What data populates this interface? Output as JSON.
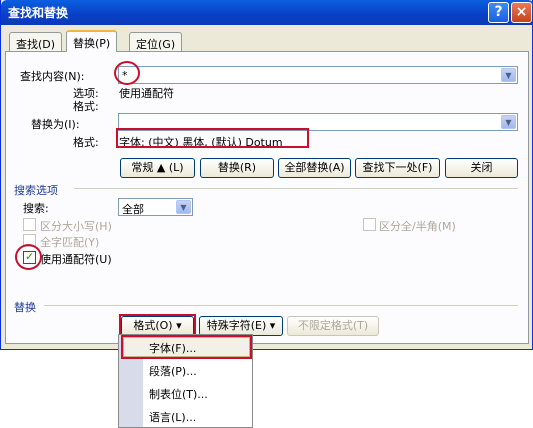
{
  "window": {
    "title": "查找和替换",
    "help": "?",
    "close": "×"
  },
  "tabs": [
    "查找(D)",
    "替换(P)",
    "定位(G)"
  ],
  "find": {
    "label": "查找内容(N):",
    "value": "*",
    "options_label": "选项:",
    "options_value": "使用通配符",
    "format_label": "格式:"
  },
  "replace": {
    "label": "替换为(I):",
    "value": "",
    "format_label": "格式:",
    "format_value": "字体: (中文) 黑体, (默认) Dotum"
  },
  "buttons": {
    "less": "常规 ▲ (L)",
    "replace": "替换(R)",
    "replace_all": "全部替换(A)",
    "find_next": "查找下一处(F)",
    "close": "关闭"
  },
  "search_options": {
    "title": "搜索选项",
    "search_label": "搜索:",
    "search_value": "全部",
    "match_case": "区分大小写(H)",
    "whole_word": "全字匹配(Y)",
    "wildcards": "使用通配符(U)",
    "width": "区分全/半角(M)"
  },
  "replace_section": {
    "title": "替换",
    "format_btn": "格式(O) ▾",
    "special_btn": "特殊字符(E) ▾",
    "no_format_btn": "不限定格式(T)"
  },
  "menu": [
    "字体(F)...",
    "段落(P)...",
    "制表位(T)...",
    "语言(L)..."
  ],
  "colors": {
    "highlight": "#c8102e"
  }
}
